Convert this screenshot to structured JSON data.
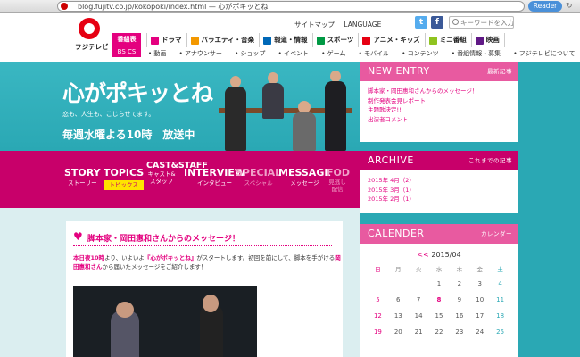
{
  "browser": {
    "url": "blog.fujitv.co.jp/kokopoki/index.html — 心がポキッとね",
    "reader_label": "Reader"
  },
  "header": {
    "logo_text": "フジテレビ",
    "sitemap": "サイトマップ",
    "language": "LANGUAGE",
    "search_placeholder": "キーワードを入力",
    "bangumi_label": "番組表",
    "bscs_label": "BS CS",
    "nav": [
      {
        "label": "ドラマ",
        "color": "#e4007f"
      },
      {
        "label": "バラエティ・音楽",
        "color": "#f39800"
      },
      {
        "label": "報道・情報",
        "color": "#0068b7"
      },
      {
        "label": "スポーツ",
        "color": "#009944"
      },
      {
        "label": "アニメ・キッズ",
        "color": "#e60012"
      },
      {
        "label": "ミニ番組",
        "color": "#8fc31f"
      },
      {
        "label": "映画",
        "color": "#601986"
      }
    ],
    "subnav": [
      "動画",
      "アナウンサー",
      "ショップ",
      "イベント",
      "ゲーム",
      "モバイル",
      "コンテンツ",
      "番組情報・募集",
      "フジテレビについて"
    ]
  },
  "hero": {
    "title": "心がポキッとね",
    "tagline": "恋も、人生も、こじらせてます。",
    "airtime": "毎週水曜よる10時　放送中"
  },
  "topic_nav": [
    {
      "en": "STORY",
      "jp": "ストーリー",
      "state": "normal"
    },
    {
      "en": "TOPICS",
      "jp": "トピックス",
      "state": "active"
    },
    {
      "en": "CAST&STAFF",
      "jp": "キャスト&スタッフ",
      "state": "normal"
    },
    {
      "en": "INTERVIEW",
      "jp": "インタビュー",
      "state": "normal"
    },
    {
      "en": "SPECIAL",
      "jp": "スペシャル",
      "state": "dim"
    },
    {
      "en": "MESSAGE",
      "jp": "メッセージ",
      "state": "normal"
    },
    {
      "en": "FOD",
      "jp": "見逃し配信",
      "state": "dim"
    }
  ],
  "sidebar": {
    "new_entry": {
      "title": "NEW ENTRY",
      "more": "最新記事",
      "items": [
        "脚本家・岡田惠和さんからのメッセージ！",
        "制作発表会見レポート！",
        "主題歌決定!!",
        "出演者コメント"
      ]
    },
    "archive": {
      "title": "ARCHIVE",
      "more": "これまでの記事",
      "items": [
        "2015年 4月（2）",
        "2015年 3月（1）",
        "2015年 2月（1）"
      ]
    },
    "calendar": {
      "title": "CALENDER",
      "more": "カレンダー",
      "prev": "<<",
      "month": "2015/04",
      "days_of_week": [
        "日",
        "月",
        "火",
        "水",
        "木",
        "金",
        "土"
      ],
      "weeks": [
        [
          "",
          "",
          "",
          "1",
          "2",
          "3",
          "4"
        ],
        [
          "5",
          "6",
          "7",
          "8",
          "9",
          "10",
          "11"
        ],
        [
          "12",
          "13",
          "14",
          "15",
          "16",
          "17",
          "18"
        ],
        [
          "19",
          "20",
          "21",
          "22",
          "23",
          "24",
          "25"
        ]
      ]
    }
  },
  "article": {
    "title": "脚本家・岡田惠和さんからのメッセージ！",
    "body_hl1": "本日夜10時",
    "body_1": "より、いよいよ",
    "body_hl2": "『心がポキッとね』",
    "body_2": "がスタートします。初回を前にして、脚本を手がける",
    "body_hl3": "岡田惠和さん",
    "body_3": "から届いたメッセージをご紹介します！"
  }
}
